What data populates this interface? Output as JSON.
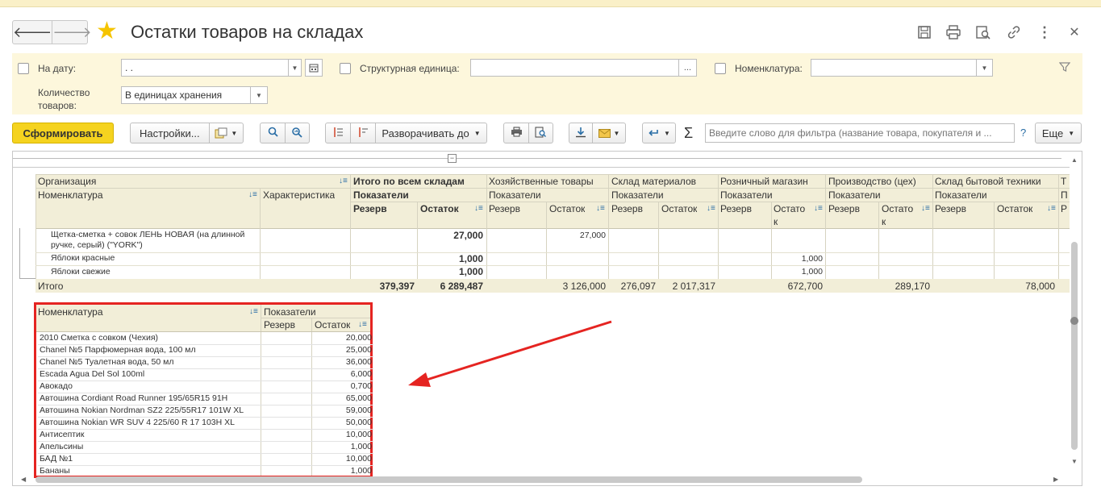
{
  "window": {
    "title": "Остатки товаров на складах"
  },
  "filters": {
    "date_label": "На дату:",
    "date_value": ". .",
    "struct_label": "Структурная единица:",
    "struct_btn": "...",
    "nom_label": "Номенклатура:",
    "qty_label_1": "Количество",
    "qty_label_2": "товаров:",
    "qty_value": "В единицах хранения"
  },
  "toolbar": {
    "generate": "Сформировать",
    "settings": "Настройки...",
    "expand": "Разворачивать до",
    "search_placeholder": "Введите слово для фильтра (название товара, покупателя и ...",
    "help": "?",
    "more": "Еще",
    "sigma": "Σ"
  },
  "report": {
    "h_org": "Организация",
    "h_nom": "Номенклатура",
    "h_char": "Характеристика",
    "h_total": "Итого по всем складам",
    "h_ind": "Показатели",
    "h_reserve": "Резерв",
    "h_rest": "Остаток",
    "h_rest_a": "Остато",
    "h_rest_b": "к",
    "warehouses": [
      "Хозяйственные товары",
      "Склад материалов",
      "Розничный магазин",
      "Производство (цех)",
      "Склад бытовой техники",
      "Т"
    ],
    "wh_ind": [
      "Показатели",
      "Показатели",
      "Показатели",
      "Показатели",
      "Показатели",
      "П"
    ],
    "rows": [
      {
        "name_1": "Щетка-сметка + совок ЛЕНЬ НОВАЯ (на длинной",
        "name_2": "ручке, серый) (\"YORK\")",
        "total_rest": "27,000",
        "w1_rest": "27,000",
        "w3_rest": "",
        "w5_rest": ""
      },
      {
        "name_1": "Яблоки красные",
        "name_2": "",
        "total_rest": "1,000",
        "w1_rest": "",
        "w3_rest": "1,000",
        "w5_rest": ""
      },
      {
        "name_1": "Яблоки свежие",
        "name_2": "",
        "total_rest": "1,000",
        "w1_rest": "",
        "w3_rest": "1,000",
        "w5_rest": ""
      }
    ],
    "total": {
      "label": "Итого",
      "reserve": "379,397",
      "rest": "6 289,487",
      "w1_rest": "3 126,000",
      "w2_reserve": "276,097",
      "w2_rest": "2 017,317",
      "w3_rest": "672,700",
      "w4_rest": "289,170",
      "w5_rest": "78,000",
      "w6": "Р"
    }
  },
  "table2": {
    "h_nom": "Номенклатура",
    "h_ind": "Показатели",
    "h_reserve": "Резерв",
    "h_rest": "Остаток",
    "rows": [
      {
        "name": "2010 Сметка с совком (Чехия)",
        "rest": "20,000"
      },
      {
        "name": "Chanel №5 Парфюмерная вода, 100 мл",
        "rest": "25,000"
      },
      {
        "name": "Chanel №5 Туалетная вода, 50 мл",
        "rest": "36,000"
      },
      {
        "name": "Escada Agua Del Sol 100ml",
        "rest": "6,000"
      },
      {
        "name": "Авокадо",
        "rest": "0,700"
      },
      {
        "name": "Автошина Cordiant Road Runner 195/65R15 91H",
        "rest": "65,000"
      },
      {
        "name": "Автошина Nokian Nordman SZ2 225/55R17 101W XL",
        "rest": "59,000"
      },
      {
        "name": "Автошина Nokian WR SUV 4 225/60 R 17 103H XL",
        "rest": "50,000"
      },
      {
        "name": "Антисептик",
        "rest": "10,000"
      },
      {
        "name": "Апельсины",
        "rest": "1,000"
      },
      {
        "name": "БАД №1",
        "rest": "10,000"
      },
      {
        "name": "Бананы",
        "rest": "1,000"
      }
    ]
  },
  "colors": {
    "accent": "#f5d31f",
    "highlight_frame": "#e52421",
    "arrow": "#e52421",
    "header_bg": "#f2eed8"
  }
}
